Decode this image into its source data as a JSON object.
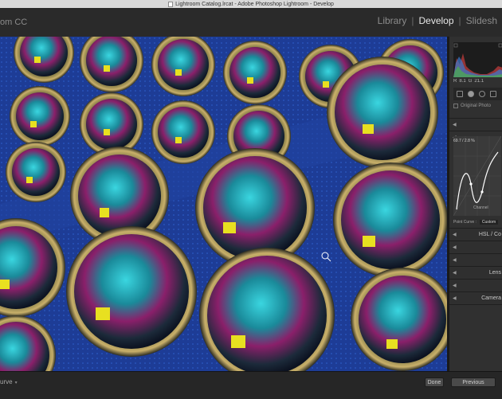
{
  "window": {
    "title": "Lightroom Catalog.lrcat - Adobe Photoshop Lightroom - Develop"
  },
  "identity": {
    "app_name_partial": "om CC"
  },
  "modules": {
    "items": [
      "Library",
      "Develop",
      "Slidesh"
    ],
    "active": "Develop"
  },
  "photo": {
    "description_icon": "loupe-cursor-icon"
  },
  "panel": {
    "readout": {
      "r_label": "R",
      "r_value": "8.1",
      "g_label": "G",
      "g_value": "21.1"
    },
    "original_photo_label": "Original Photo",
    "curve_value": "69.7 / 2.8 %",
    "curve_channel_label": "Channel",
    "point_curve_label": "Point Curve :",
    "point_curve_value": "Custom",
    "sections": [
      "HSL",
      "Lens",
      "Camera"
    ],
    "section_partial_suffix": " / Co"
  },
  "toolbar": {
    "view_label": "urve",
    "done_label": "Done",
    "previous_label": "Previous"
  },
  "colors": {
    "accent_photo_bg": "#1e3f9a",
    "panel_bg": "#303030"
  }
}
